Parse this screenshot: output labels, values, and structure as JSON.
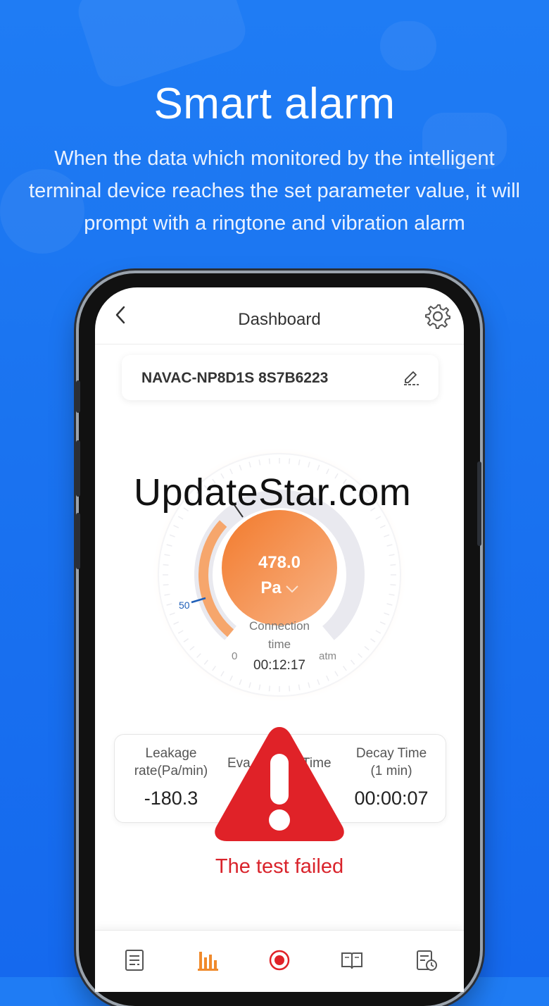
{
  "hero": {
    "title": "Smart alarm",
    "subtitle": "When the data which monitored by the intelligent terminal device reaches the set parameter value, it will prompt with a ringtone and vibration alarm"
  },
  "appbar": {
    "title": "Dashboard",
    "back_icon": "chevron-left-icon",
    "settings_icon": "gear-icon"
  },
  "device": {
    "name": "NAVAC-NP8D1S 8S7B6223",
    "edit_icon": "edit-icon"
  },
  "gauge": {
    "value": "478.0",
    "unit": "Pa",
    "tick_50": "50",
    "tick_0": "0",
    "tick_atm": "atm",
    "connection_label_1": "Connection",
    "connection_label_2": "time",
    "connection_time": "00:12:17",
    "fill_fraction": 0.33
  },
  "watermark": "UpdateStar.com",
  "stats": {
    "leakage_label_1": "Leakage",
    "leakage_label_2": "rate(Pa/min)",
    "leakage_value": "-180.3",
    "evac_label_left": "Eva",
    "evac_label_right": "Time",
    "decay_label_1": "Decay Time",
    "decay_label_2": "(1 min)",
    "decay_value": "00:00:07"
  },
  "alert": {
    "icon": "warning-triangle-icon",
    "message": "The test failed",
    "color": "#e02228"
  },
  "bottom_nav": {
    "items": [
      "report-icon",
      "bar-chart-icon",
      "record-icon",
      "book-icon",
      "history-icon"
    ],
    "active_color": "#f08a2c",
    "record_color": "#e02228"
  }
}
